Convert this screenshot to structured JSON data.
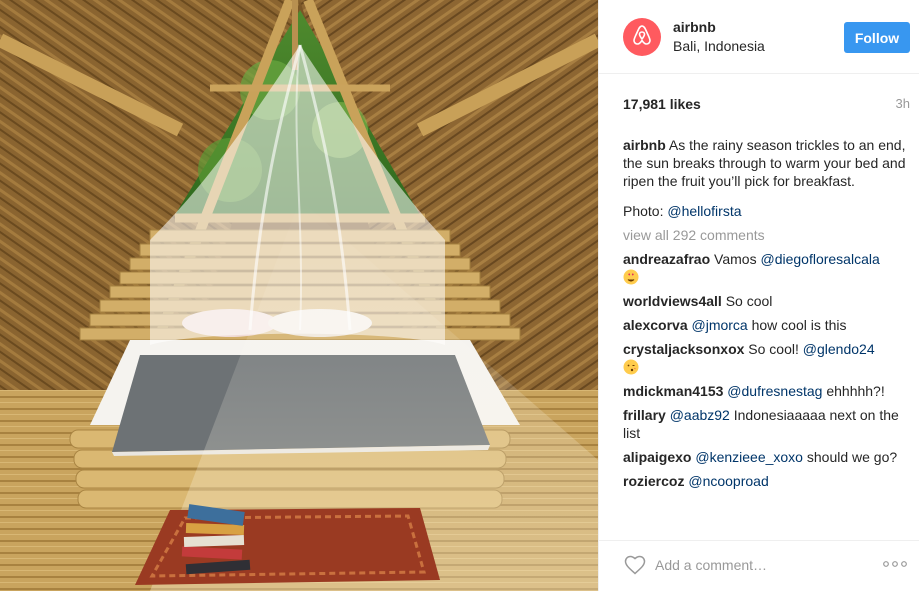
{
  "post": {
    "username": "airbnb",
    "location": "Bali, Indonesia",
    "follow_label": "Follow",
    "likes": "17,981 likes",
    "time_ago": "3h",
    "caption_user": "airbnb",
    "caption_text": "As the rainy season trickles to an end, the sun breaks through to warm your bed and ripen the fruit you’ll pick for breakfast.",
    "photo_credit_prefix": "Photo: ",
    "photo_credit_mention": "@hellofirsta",
    "view_all": "view all 292 comments"
  },
  "comments": [
    {
      "user": "andreazafrao",
      "pre": "Vamos ",
      "mention": "@diegofloresalcala",
      "post": "",
      "emoji": "heart-eyes-emoji"
    },
    {
      "user": "worldviews4all",
      "pre": "So cool",
      "mention": "",
      "post": "",
      "emoji": ""
    },
    {
      "user": "alexcorva",
      "pre": "",
      "mention": "@jmorca",
      "post": " how cool is this",
      "emoji": ""
    },
    {
      "user": "crystaljacksonxox",
      "pre": "So cool! ",
      "mention": "@glendo24",
      "post": "",
      "emoji": "kiss-face-emoji"
    },
    {
      "user": "mdickman4153",
      "pre": "",
      "mention": "@dufresnestag",
      "post": " ehhhhh?!",
      "emoji": ""
    },
    {
      "user": "frillary",
      "pre": "",
      "mention": "@aabz92",
      "post": " Indonesiaaaaa next on the list",
      "emoji": ""
    },
    {
      "user": "alipaigexo",
      "pre": "",
      "mention": "@kenzieee_xoxo",
      "post": " should we go?",
      "emoji": ""
    },
    {
      "user": "roziercoz",
      "pre": "",
      "mention": "@ncooproad",
      "post": "",
      "emoji": ""
    }
  ],
  "footer": {
    "comment_placeholder": "Add a comment…"
  },
  "colors": {
    "follow_button": "#3897f0",
    "avatar_brand": "#ff5a5f",
    "mention": "#003569",
    "muted": "#999999"
  },
  "icons": [
    "airbnb-logo-icon",
    "heart-icon",
    "more-options-icon"
  ]
}
